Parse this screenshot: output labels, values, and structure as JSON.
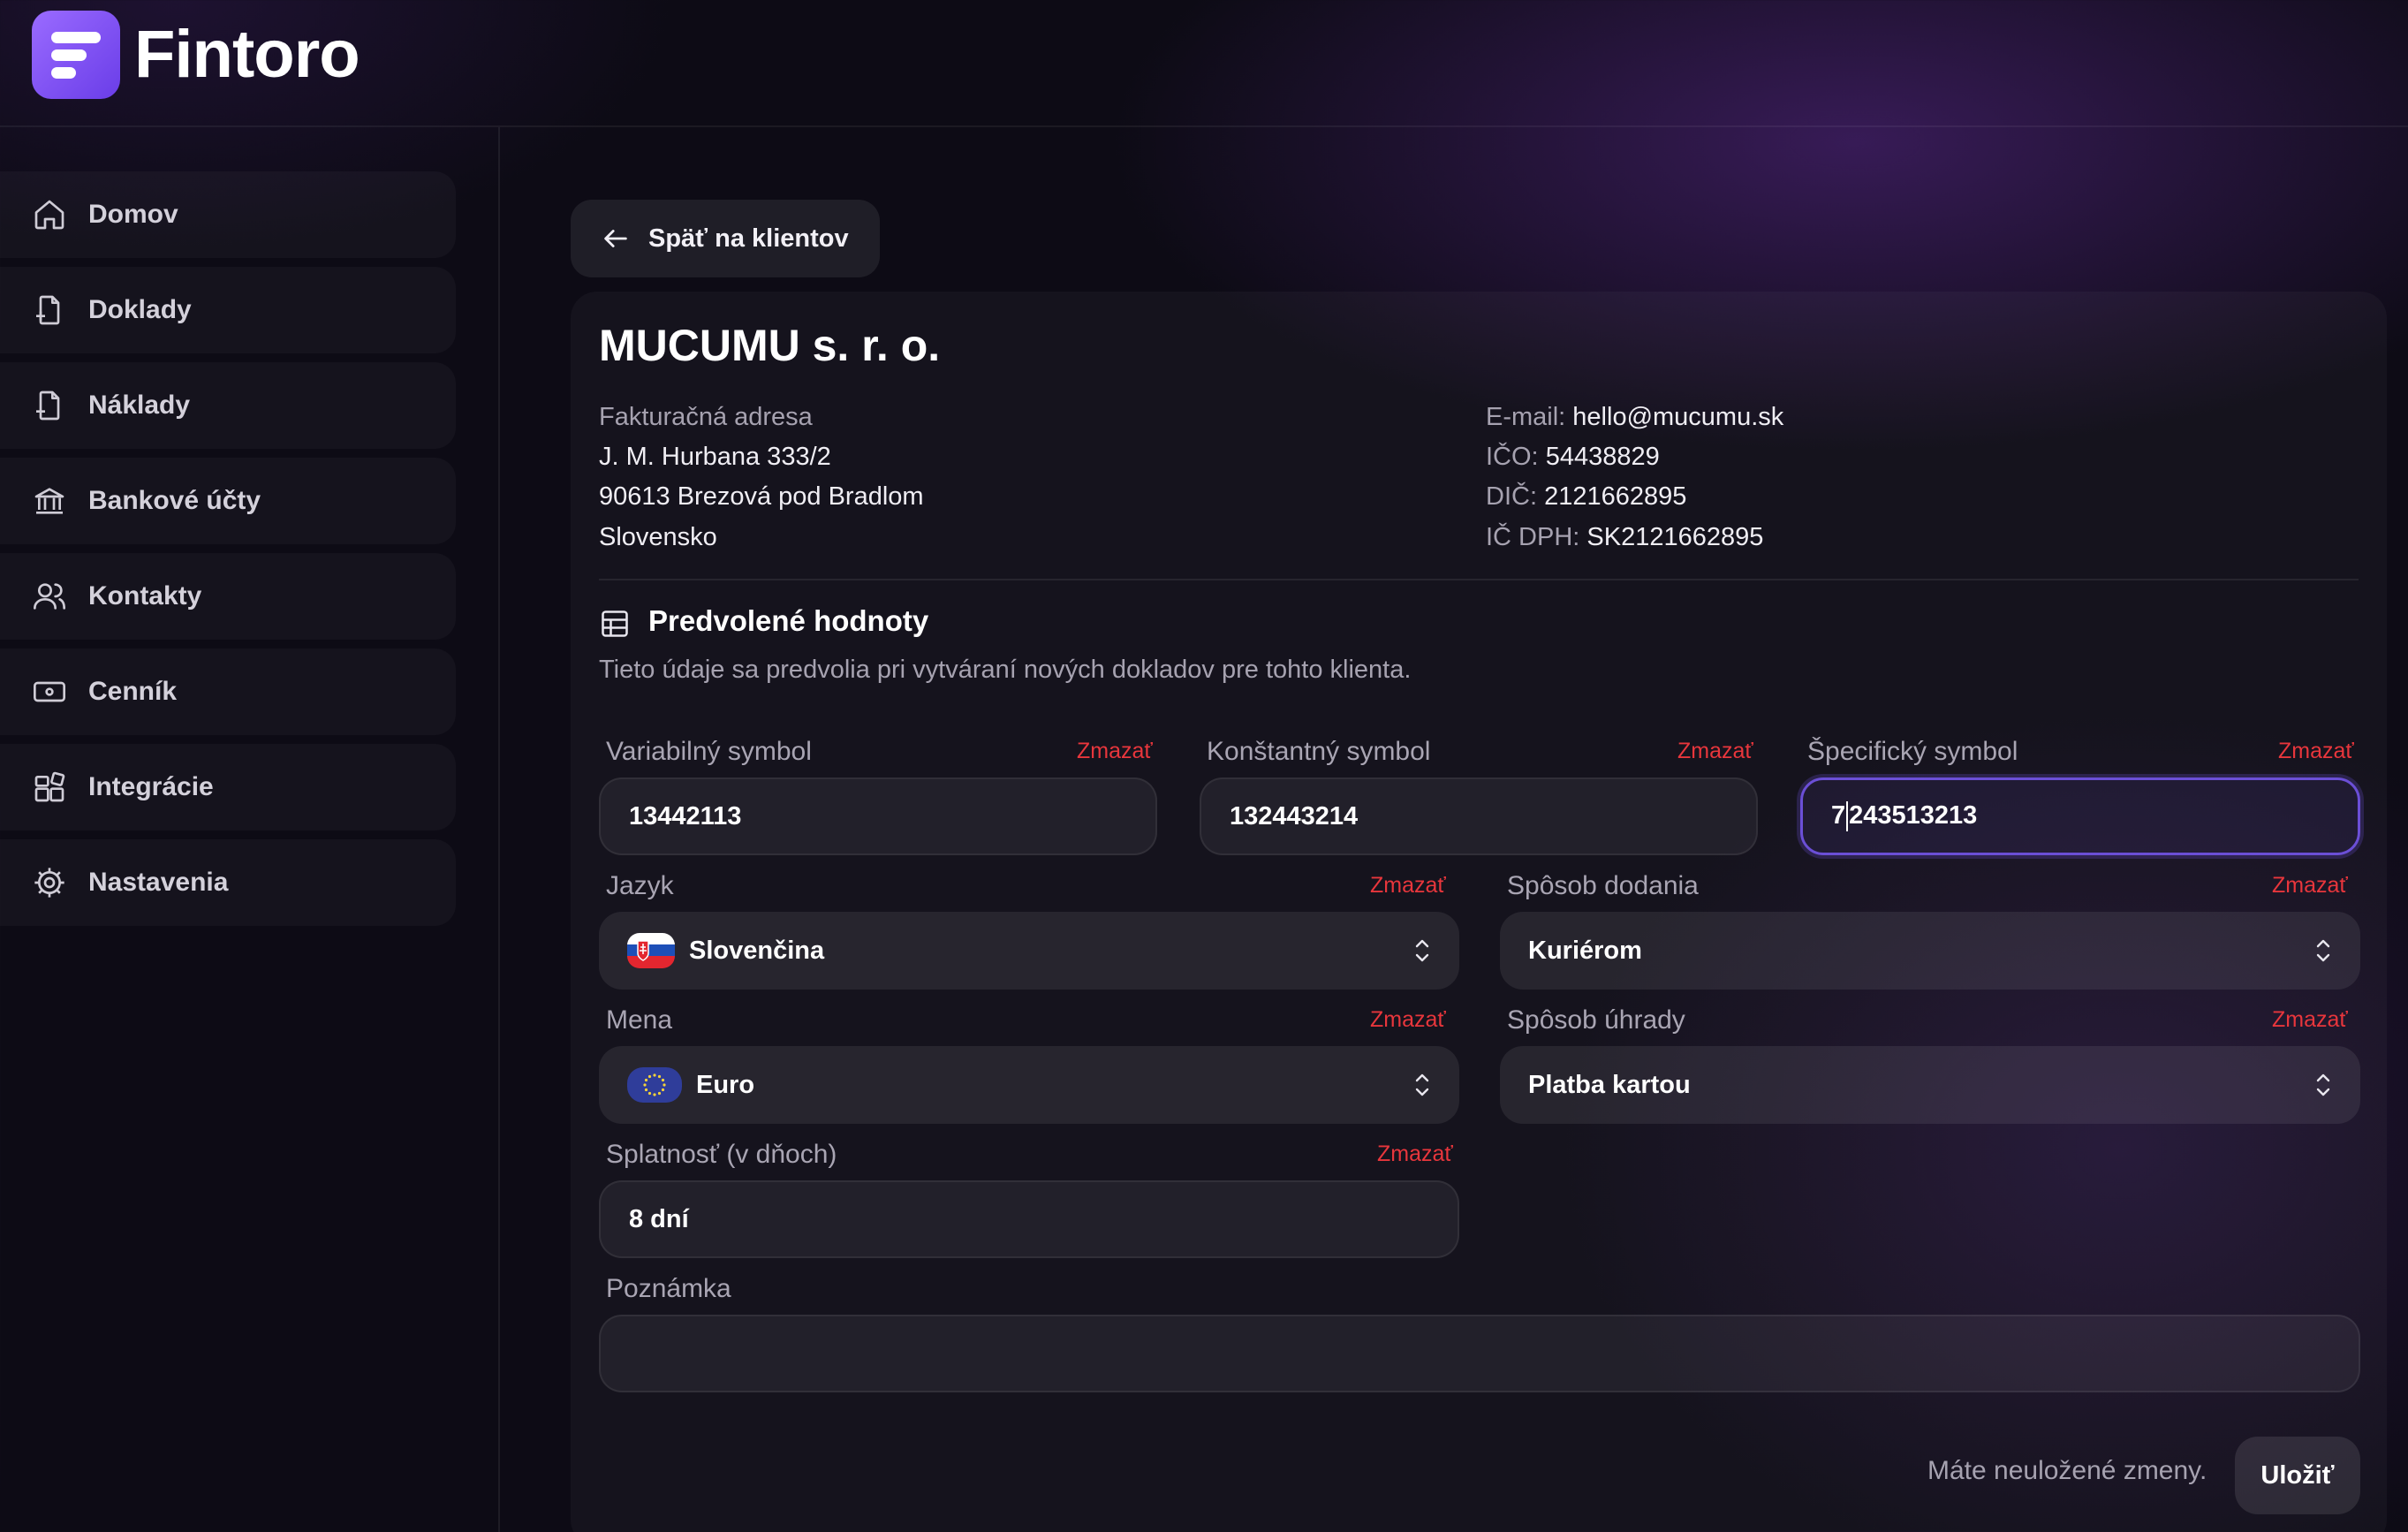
{
  "app": {
    "name": "Fintoro"
  },
  "sidebar": {
    "items": [
      {
        "label": "Domov",
        "icon": "home-icon"
      },
      {
        "label": "Doklady",
        "icon": "document-plus-icon"
      },
      {
        "label": "Náklady",
        "icon": "document-minus-icon"
      },
      {
        "label": "Bankové účty",
        "icon": "bank-icon"
      },
      {
        "label": "Kontakty",
        "icon": "users-icon"
      },
      {
        "label": "Cenník",
        "icon": "banknote-icon"
      },
      {
        "label": "Integrácie",
        "icon": "integrations-icon"
      },
      {
        "label": "Nastavenia",
        "icon": "gear-icon"
      }
    ]
  },
  "back_button": {
    "label": "Späť na klientov"
  },
  "client": {
    "name": "MUCUMU s. r. o.",
    "address_label": "Fakturačná adresa",
    "street": "J. M. Hurbana 333/2",
    "city": "90613 Brezová pod Bradlom",
    "country": "Slovensko",
    "email_label": "E-mail:",
    "email": "hello@mucumu.sk",
    "ico_label": "IČO:",
    "ico": "54438829",
    "dic_label": "DIČ:",
    "dic": "2121662895",
    "icdph_label": "IČ DPH:",
    "icdph": "SK2121662895"
  },
  "defaults": {
    "title": "Predvolené hodnoty",
    "description": "Tieto údaje sa predvolia pri vytváraní nových dokladov pre tohto klienta.",
    "clear_label": "Zmazať",
    "variable_symbol": {
      "label": "Variabilný symbol",
      "value": "13442113"
    },
    "constant_symbol": {
      "label": "Konštantný symbol",
      "value": "132443214"
    },
    "specific_symbol": {
      "label": "Špecifický symbol",
      "value_before_caret": "7",
      "value_after_caret": "243513213"
    },
    "language": {
      "label": "Jazyk",
      "value": "Slovenčina"
    },
    "delivery": {
      "label": "Spôsob dodania",
      "value": "Kuriérom"
    },
    "currency": {
      "label": "Mena",
      "value": "Euro"
    },
    "payment": {
      "label": "Spôsob úhrady",
      "value": "Platba kartou"
    },
    "due": {
      "label": "Splatnosť (v dňoch)",
      "value": "8 dní"
    },
    "note": {
      "label": "Poznámka",
      "value": ""
    }
  },
  "footer": {
    "unsaved_text": "Máte neuložené zmeny.",
    "save_label": "Uložiť"
  },
  "colors": {
    "accent": "#7b4dff",
    "danger": "#e8363c",
    "background": "#0d0b15"
  }
}
